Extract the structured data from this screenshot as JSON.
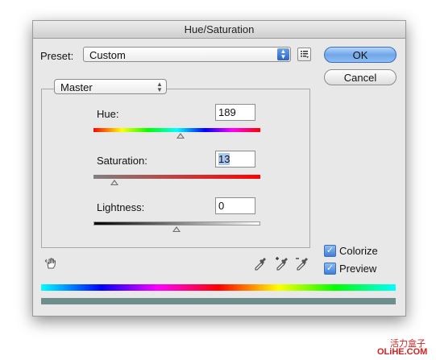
{
  "window": {
    "title": "Hue/Saturation"
  },
  "preset": {
    "label": "Preset:",
    "value": "Custom"
  },
  "buttons": {
    "ok": "OK",
    "cancel": "Cancel"
  },
  "channel": {
    "value": "Master"
  },
  "hue": {
    "label": "Hue:",
    "value": "189",
    "slider_level_percent": 52
  },
  "saturation": {
    "label": "Saturation:",
    "value": "13",
    "slider_level_percent": 12
  },
  "lightness": {
    "label": "Lightness:",
    "value": "0",
    "slider_level_percent": 50
  },
  "options": {
    "colorize": "Colorize",
    "preview": "Preview",
    "colorize_checked": true,
    "preview_checked": true
  },
  "watermark": {
    "line1": "活力盒子",
    "line2": "OLiHE.COM"
  },
  "icons": [
    "preset-options-icon",
    "hand-adjust-icon",
    "eyedropper-icon",
    "eyedropper-plus-icon",
    "eyedropper-minus-icon",
    "up-down-arrows-icon",
    "checkmark-icon"
  ],
  "colors": {
    "ok_blue": "#6fa6ea",
    "result_bar": "#6e8e8e",
    "watermark_red": "#d42020"
  }
}
